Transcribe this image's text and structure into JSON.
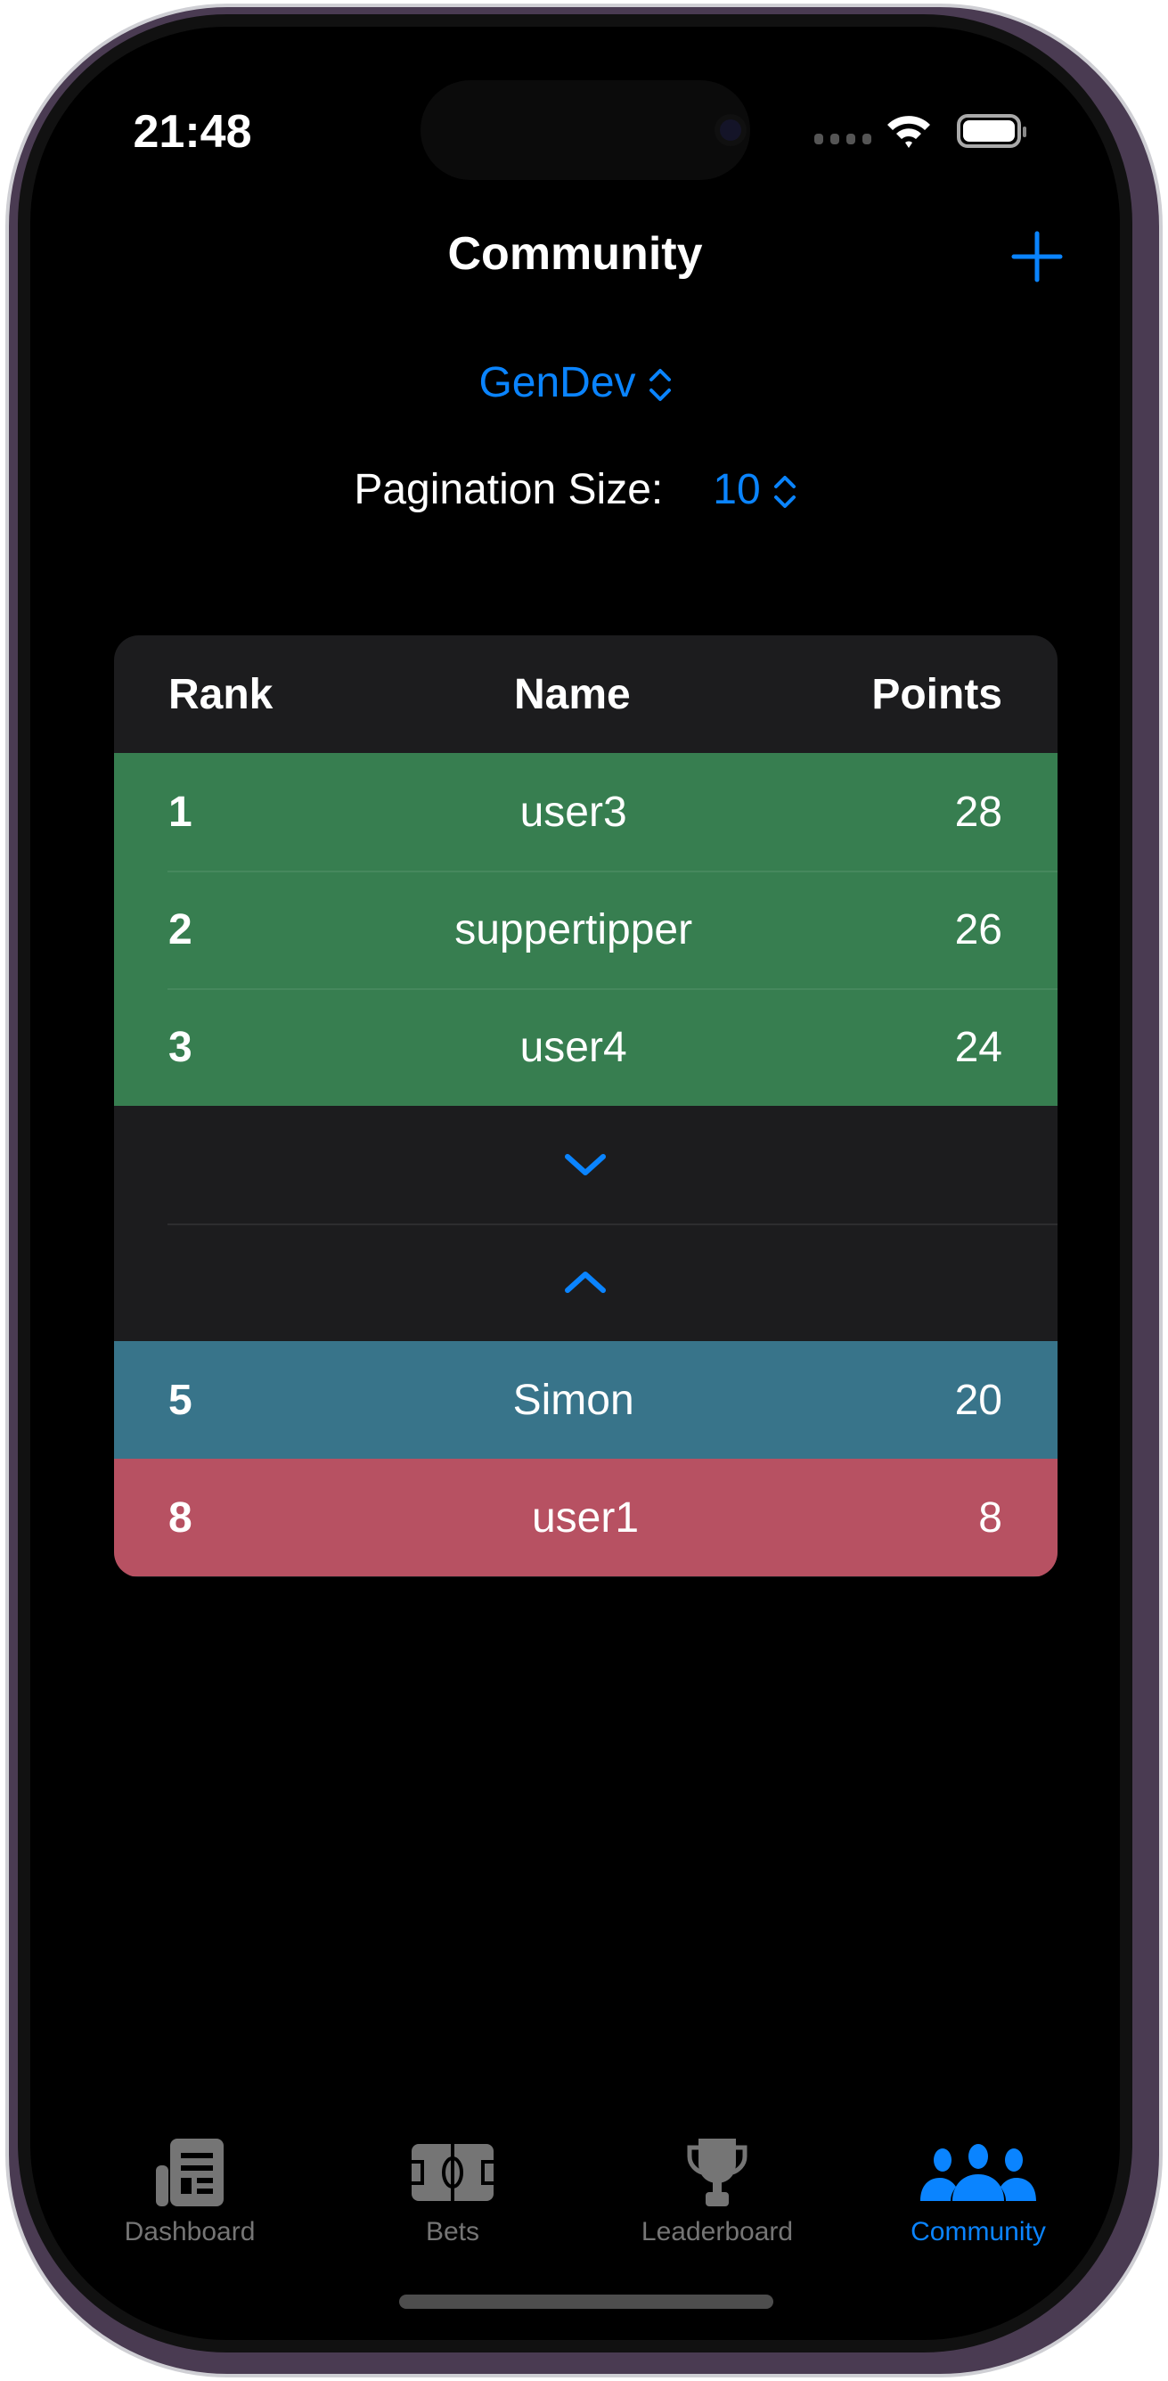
{
  "status_bar": {
    "time": "21:48"
  },
  "header": {
    "title": "Community",
    "add_icon": "plus-icon"
  },
  "community_selector": {
    "value": "GenDev"
  },
  "pagination": {
    "label": "Pagination Size:",
    "value": "10"
  },
  "leaderboard": {
    "columns": [
      "Rank",
      "Name",
      "Points"
    ],
    "rows": [
      {
        "rank": "1",
        "name": "user3",
        "points": "28",
        "color": "#377e50"
      },
      {
        "rank": "2",
        "name": "suppertipper",
        "points": "26",
        "color": "#377e50"
      },
      {
        "rank": "3",
        "name": "user4",
        "points": "24",
        "color": "#377e50"
      },
      {
        "rank": "5",
        "name": "Simon",
        "points": "20",
        "color": "#38748a"
      },
      {
        "rank": "8",
        "name": "user1",
        "points": "8",
        "color": "#b75162"
      }
    ]
  },
  "tabs": [
    {
      "label": "Dashboard",
      "icon": "newspaper-icon"
    },
    {
      "label": "Bets",
      "icon": "soccer-field-icon"
    },
    {
      "label": "Leaderboard",
      "icon": "trophy-icon"
    },
    {
      "label": "Community",
      "icon": "people-icon",
      "active": true
    }
  ],
  "colors": {
    "accent": "#0a84ff",
    "inactive": "#757575",
    "card": "#1c1c1e"
  }
}
